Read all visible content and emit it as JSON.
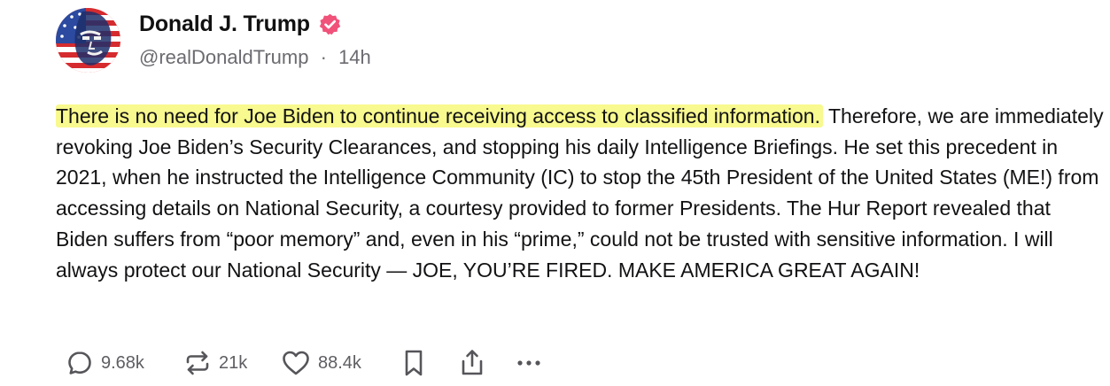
{
  "author": {
    "display_name": "Donald J. Trump",
    "handle": "@realDonaldTrump",
    "separator": "·",
    "time": "14h",
    "verified": true,
    "verified_color": "#f0527a"
  },
  "post": {
    "highlighted_text": "There is no need for Joe Biden to continue receiving access to classified information.",
    "body_text": " Therefore, we are immediately revoking Joe Biden’s Security Clearances, and stopping his daily Intelligence Briefings. He set this precedent in 2021, when he instructed the Intelligence Community (IC) to stop the 45th President of the United States (ME!) from accessing details on National Security, a courtesy provided to former Presidents. The Hur Report revealed that Biden suffers from “poor memory” and, even in his “prime,” could not be trusted with sensitive information. I will always protect our National Security — JOE, YOU’RE FIRED. MAKE AMERICA GREAT AGAIN!",
    "highlight_color": "#f8f98e"
  },
  "actions": {
    "reply_count": "9.68k",
    "repost_count": "21k",
    "like_count": "88.4k",
    "icons": [
      "reply-icon",
      "repost-icon",
      "like-icon",
      "bookmark-icon",
      "share-icon",
      "more-icon"
    ]
  }
}
